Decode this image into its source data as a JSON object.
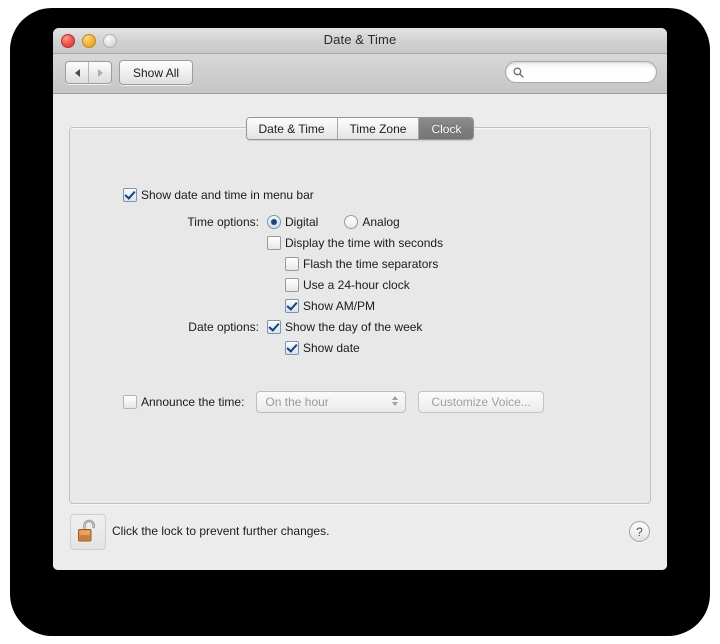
{
  "window": {
    "title": "Date & Time",
    "traffic_lights": [
      "close-button",
      "minimize-button",
      "zoom-button"
    ]
  },
  "toolbar": {
    "back_label": "◀",
    "forward_label": "▶",
    "show_all_label": "Show All",
    "search": {
      "value": "",
      "placeholder": "",
      "icon": "search-icon"
    }
  },
  "tabs": [
    {
      "label": "Date & Time",
      "active": false
    },
    {
      "label": "Time Zone",
      "active": false
    },
    {
      "label": "Clock",
      "active": true
    }
  ],
  "panel": {
    "menu_bar_checkbox": {
      "label": "Show date and time in menu bar",
      "checked": true
    },
    "time_options": {
      "label": "Time options:",
      "radios": [
        {
          "label": "Digital",
          "selected": true
        },
        {
          "label": "Analog",
          "selected": false
        }
      ],
      "checkboxes": [
        {
          "label": "Display the time with seconds",
          "checked": false
        },
        {
          "label": "Flash the time separators",
          "checked": false
        },
        {
          "label": "Use a 24-hour clock",
          "checked": false
        },
        {
          "label": "Show AM/PM",
          "checked": true
        }
      ]
    },
    "date_options": {
      "label": "Date options:",
      "checkboxes": [
        {
          "label": "Show the day of the week",
          "checked": true
        },
        {
          "label": "Show date",
          "checked": true
        }
      ]
    },
    "announce": {
      "checkbox_label": "Announce the time:",
      "checked": false,
      "select_value": "On the hour",
      "button_label": "Customize Voice...",
      "disabled": true
    }
  },
  "footer": {
    "lock_icon": "unlocked-padlock-icon",
    "lock_text": "Click the lock to prevent further changes.",
    "help_label": "?"
  },
  "colors": {
    "accent_blue": "#20447a",
    "active_tab_bg": "#7e7e7e",
    "window_bg": "#ececec",
    "panel_bg": "#e8e8e8",
    "lock_body": "#d98a4a"
  }
}
